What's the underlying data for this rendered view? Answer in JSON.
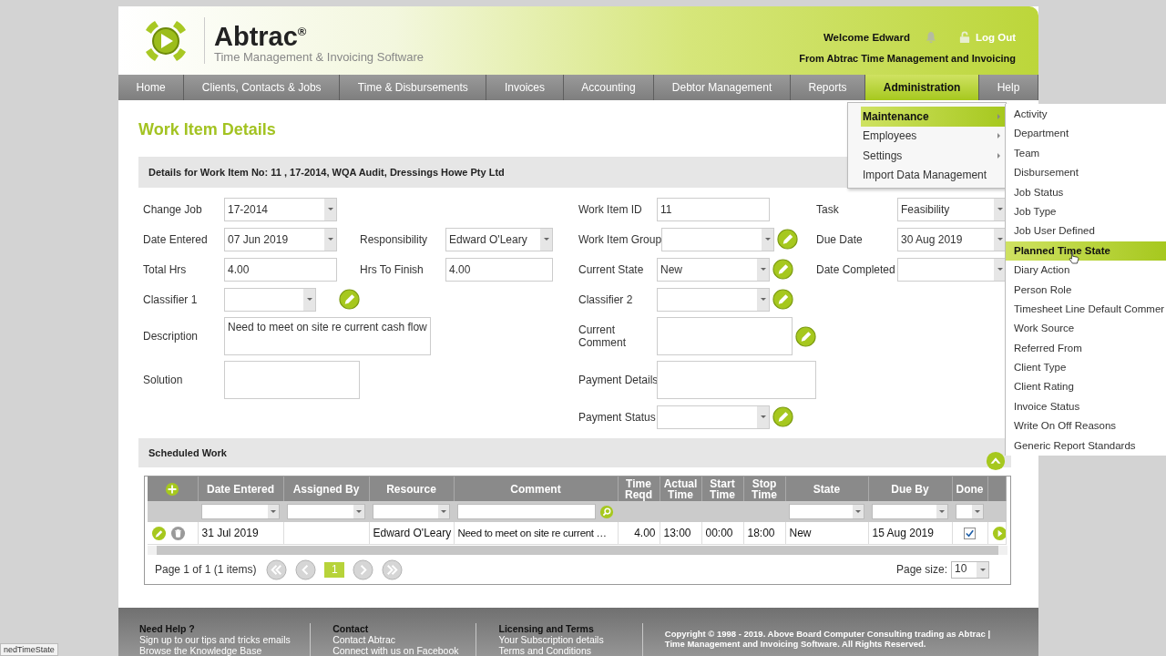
{
  "header": {
    "brand": "Abtrac$^{®}$",
    "tagline": "Time Management & Invoicing Software",
    "welcome": "Welcome Edward",
    "logout": "Log Out",
    "subtitle": "From Abtrac Time Management and Invoicing"
  },
  "nav": [
    {
      "label": "Home",
      "selected": false
    },
    {
      "label": "Clients, Contacts & Jobs",
      "selected": false
    },
    {
      "label": "Time & Disbursements",
      "selected": false
    },
    {
      "label": "Invoices",
      "selected": false
    },
    {
      "label": "Accounting",
      "selected": false
    },
    {
      "label": "Debtor Management",
      "selected": false
    },
    {
      "label": "Reports",
      "selected": false
    },
    {
      "label": "Administration",
      "selected": true
    },
    {
      "label": "Help",
      "selected": false
    }
  ],
  "admin_menu": [
    {
      "label": "Maintenance",
      "selected": true,
      "has_submenu": true
    },
    {
      "label": "Employees",
      "selected": false,
      "has_submenu": true
    },
    {
      "label": "Settings",
      "selected": false,
      "has_submenu": true
    },
    {
      "label": "Import Data Management",
      "selected": false,
      "has_submenu": false
    }
  ],
  "maintenance_submenu": [
    {
      "label": "Activity",
      "selected": false
    },
    {
      "label": "Department",
      "selected": false
    },
    {
      "label": "Team",
      "selected": false
    },
    {
      "label": "Disbursement",
      "selected": false
    },
    {
      "label": "Job Status",
      "selected": false
    },
    {
      "label": "Job Type",
      "selected": false
    },
    {
      "label": "Job User Defined",
      "selected": false
    },
    {
      "label": "Planned Time State",
      "selected": true
    },
    {
      "label": "Diary Action",
      "selected": false
    },
    {
      "label": "Person Role",
      "selected": false
    },
    {
      "label": "Timesheet Line Default Commer",
      "selected": false
    },
    {
      "label": "Work Source",
      "selected": false
    },
    {
      "label": "Referred From",
      "selected": false
    },
    {
      "label": "Client Type",
      "selected": false
    },
    {
      "label": "Client Rating",
      "selected": false
    },
    {
      "label": "Invoice Status",
      "selected": false
    },
    {
      "label": "Write On Off Reasons",
      "selected": false
    },
    {
      "label": "Generic Report Standards",
      "selected": false
    }
  ],
  "page_title": "Work Item Details",
  "details_heading": "Details for Work Item No: 11 , 17-2014, WQA Audit, Dressings Howe Pty Ltd",
  "form_rows": [
    {
      "left": [
        {
          "label": "Change Job",
          "kind": "select",
          "value": "17-2014",
          "edit_button": false
        }
      ],
      "right": [
        {
          "label": "Work Item ID",
          "kind": "text",
          "value": "11",
          "edit_button": false
        },
        {
          "label": "Task",
          "kind": "select",
          "value": "Feasibility",
          "edit_button": false
        }
      ]
    },
    {
      "left": [
        {
          "label": "Date Entered",
          "kind": "select",
          "value": "07 Jun 2019",
          "edit_button": false
        },
        {
          "label": "Responsibility",
          "kind": "select",
          "value": "Edward O'Leary",
          "edit_button": false
        }
      ],
      "right": [
        {
          "label": "Work Item Group",
          "kind": "select",
          "edit_button": true
        },
        {
          "label": "Due Date",
          "kind": "select",
          "value": "30 Aug 2019",
          "edit_button": false
        }
      ]
    },
    {
      "left": [
        {
          "label": "Total Hrs",
          "kind": "text",
          "value": "4.00",
          "edit_button": false
        },
        {
          "label": "Hrs To Finish",
          "kind": "text",
          "value": "4.00",
          "edit_button": false
        }
      ],
      "right": [
        {
          "label": "Current State",
          "kind": "select",
          "value": "New",
          "edit_button": true
        },
        {
          "label": "Date Completed",
          "kind": "select",
          "edit_button": false
        }
      ]
    },
    {
      "left": [
        {
          "label": "Classifier 1",
          "kind": "select",
          "edit_button": true
        }
      ],
      "right": [
        {
          "label": "Classifier 2",
          "kind": "select",
          "edit_button": true
        }
      ]
    },
    {
      "left": [
        {
          "label": "Description",
          "kind": "textarea",
          "value": "Need to meet on site re current cash flow",
          "edit_button": false
        }
      ],
      "right": [
        {
          "label": "Current Comment",
          "kind": "textarea",
          "edit_button": true
        }
      ]
    },
    {
      "left": [
        {
          "label": "Solution",
          "kind": "textarea",
          "edit_button": false
        }
      ],
      "right": [
        {
          "label": "Payment Details",
          "kind": "textarea",
          "edit_button": false
        }
      ]
    },
    {
      "left": [],
      "right": [
        {
          "label": "Payment Status",
          "kind": "select",
          "edit_button": true
        }
      ]
    }
  ],
  "scheduled_work": {
    "heading": "Scheduled Work",
    "columns": [
      "Date Entered",
      "Assigned By",
      "Resource",
      "Comment",
      "Time Reqd",
      "Actual Time",
      "Start Time",
      "Stop Time",
      "State",
      "Due By",
      "Done"
    ],
    "rows": [
      {
        "cells": [
          "31 Jul 2019",
          null,
          "Edward O'Leary",
          "Need to meet on site re current …",
          "4.00",
          "13:00",
          "00:00",
          "18:00",
          "New",
          "15 Aug 2019"
        ],
        "done": true
      }
    ],
    "pager": {
      "summary": "Page 1 of 1 (1 items)",
      "pages": [
        {
          "label": "1",
          "selected": true
        }
      ],
      "page_size_label": "Page size:",
      "page_size": "10"
    }
  },
  "footer": [
    {
      "heading": "Need Help ?",
      "links": [
        "Sign up to our tips and tricks emails",
        "Browse the Knowledge Base"
      ]
    },
    {
      "heading": "Contact",
      "links": [
        "Contact Abtrac",
        "Connect with us on Facebook"
      ]
    },
    {
      "heading": "Licensing and Terms",
      "links": [
        "Your Subscription details",
        "Terms and Conditions"
      ]
    }
  ],
  "copyright": "Copyright © 1998 - 2019. Above Board Computer Consulting trading as Abtrac | Time Management and Invoicing Software. All Rights Reserved.",
  "status_tooltip": "nedTimeState"
}
